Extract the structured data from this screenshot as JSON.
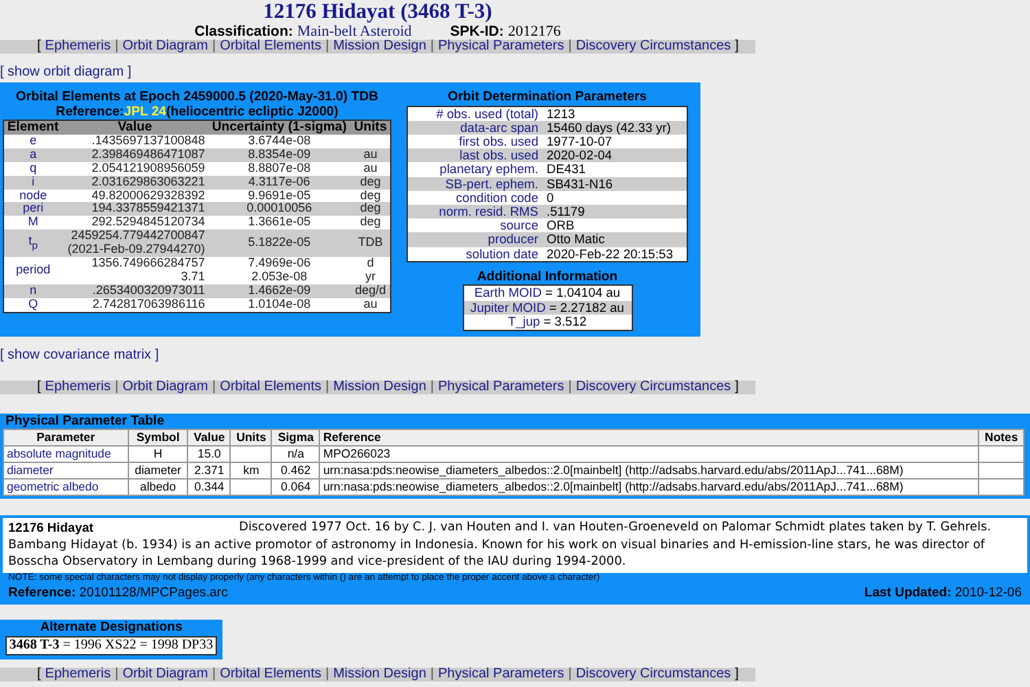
{
  "title": "12176 Hidayat (3468 T-3)",
  "classification": {
    "label": "Classification:",
    "value": "Main-belt Asteroid"
  },
  "spk_id": {
    "label": "SPK-ID:",
    "value": "2012176"
  },
  "nav_top": {
    "open": "[",
    "separator": "|",
    "close": "]",
    "links": [
      "Ephemeris",
      "Orbit Diagram",
      "Orbital Elements",
      "Mission Design",
      "Physical Parameters",
      "Discovery Circumstances"
    ]
  },
  "show_orbit_diagram": "[ show orbit diagram ]",
  "orbital_elements": {
    "title": "Orbital Elements at Epoch 2459000.5 (2020-May-31.0) TDB",
    "reference_label": "Reference:",
    "reference_value": "JPL 24",
    "reference_frame": "(heliocentric ecliptic J2000)",
    "columns": [
      "Element",
      "Value",
      "Uncertainty (1-sigma)",
      "Units"
    ],
    "rows": [
      {
        "element": "e",
        "value": [
          ".1435697137100848"
        ],
        "uncertainty": [
          "3.6744e-08"
        ],
        "units": []
      },
      {
        "element": "a",
        "value": [
          "2.398469486471087"
        ],
        "uncertainty": [
          "8.8354e-09"
        ],
        "units": [
          "au"
        ]
      },
      {
        "element": "q",
        "value": [
          "2.054121908956059"
        ],
        "uncertainty": [
          "8.8807e-08"
        ],
        "units": [
          "au"
        ]
      },
      {
        "element": "i",
        "value": [
          "2.031629863063221"
        ],
        "uncertainty": [
          "4.3117e-06"
        ],
        "units": [
          "deg"
        ]
      },
      {
        "element": "node",
        "value": [
          "49.82000629328392"
        ],
        "uncertainty": [
          "9.9691e-05"
        ],
        "units": [
          "deg"
        ]
      },
      {
        "element": "peri",
        "value": [
          "194.3378559421371"
        ],
        "uncertainty": [
          "0.00010056"
        ],
        "units": [
          "deg"
        ]
      },
      {
        "element": "M",
        "value": [
          "292.5294845120734"
        ],
        "uncertainty": [
          "1.3661e-05"
        ],
        "units": [
          "deg"
        ]
      },
      {
        "element": "t$_{p}$",
        "value": [
          "2459254.779442700847",
          "(2021-Feb-09.27944270)"
        ],
        "uncertainty": [
          "5.1822e-05"
        ],
        "units": [
          "TDB"
        ]
      },
      {
        "element": "period",
        "value": [
          "1356.749666284757",
          "3.71"
        ],
        "uncertainty": [
          "7.4969e-06",
          "2.053e-08"
        ],
        "units": [
          "d",
          "yr"
        ]
      },
      {
        "element": "n",
        "value": [
          ".2653400320973011"
        ],
        "uncertainty": [
          "1.4662e-09"
        ],
        "units": [
          "deg/d"
        ]
      },
      {
        "element": "Q",
        "value": [
          "2.742817063986116"
        ],
        "uncertainty": [
          "1.0104e-08"
        ],
        "units": [
          "au"
        ]
      }
    ]
  },
  "orbit_determination": {
    "title": "Orbit Determination Parameters",
    "rows": [
      {
        "label": "# obs. used (total)",
        "value": "1213"
      },
      {
        "label": "data-arc span",
        "value": "15460 days (42.33 yr)"
      },
      {
        "label": "first obs. used",
        "value": "1977-10-07"
      },
      {
        "label": "last obs. used",
        "value": "2020-02-04"
      },
      {
        "label": "planetary ephem.",
        "value": "DE431"
      },
      {
        "label": "SB-pert. ephem.",
        "value": "SB431-N16"
      },
      {
        "label": "condition code",
        "value": "0"
      },
      {
        "label": "norm. resid. RMS",
        "value": ".51179"
      },
      {
        "label": "source",
        "value": "ORB"
      },
      {
        "label": "producer",
        "value": "Otto Matic"
      },
      {
        "label": "solution date",
        "value": "2020-Feb-22 20:15:53"
      }
    ]
  },
  "additional_information": {
    "title": "Additional Information",
    "rows": [
      {
        "label": "Earth MOID",
        "value": "= 1.04104 au"
      },
      {
        "label": "Jupiter MOID",
        "value": "= 2.27182 au"
      },
      {
        "label": "T_jup",
        "value": "= 3.512"
      }
    ]
  },
  "show_covariance_matrix": "[ show covariance matrix ]",
  "nav_middle": {
    "open": "[",
    "separator": "|",
    "close": "]",
    "links": [
      "Ephemeris",
      "Orbit Diagram",
      "Orbital Elements",
      "Mission Design",
      "Physical Parameters",
      "Discovery Circumstances"
    ]
  },
  "physical_parameters": {
    "title": "Physical Parameter Table",
    "columns": [
      "Parameter",
      "Symbol",
      "Value",
      "Units",
      "Sigma",
      "Reference",
      "Notes"
    ],
    "rows": [
      {
        "parameter": "absolute magnitude",
        "symbol": "H",
        "value": "15.0",
        "units": "",
        "sigma": "n/a",
        "reference": "MPO266023",
        "notes": ""
      },
      {
        "parameter": "diameter",
        "symbol": "diameter",
        "value": "2.371",
        "units": "km",
        "sigma": "0.462",
        "reference": "urn:nasa:pds:neowise_diameters_albedos::2.0[mainbelt] (http://adsabs.harvard.edu/abs/2011ApJ...741...68M)",
        "notes": ""
      },
      {
        "parameter": "geometric albedo",
        "symbol": "albedo",
        "value": "0.344",
        "units": "",
        "sigma": "0.064",
        "reference": "urn:nasa:pds:neowise_diameters_albedos::2.0[mainbelt] (http://adsabs.harvard.edu/abs/2011ApJ...741...68M)",
        "notes": ""
      }
    ]
  },
  "discovery": {
    "name": "12176 Hidayat",
    "circumstances": "Discovered 1977 Oct. 16 by C. J. van Houten and I. van Houten-Groeneveld on Palomar Schmidt plates taken by T. Gehrels.",
    "citation": "Bambang Hidayat (b. 1934) is an active promotor of astronomy in Indonesia. Known for his work on visual binaries and H-emission-line stars, he was director of Bosscha Observatory in Lembang during 1968-1999 and vice-president of the IAU during 1994-2000.",
    "note": "NOTE: some special characters may not display properly (any characters within () are an attempt to place the proper accent above a character)",
    "reference_label": "Reference:",
    "reference_value": "20101128/MPCPages.arc",
    "updated_label": "Last Updated:",
    "updated_value": "2010-12-06"
  },
  "alternate_designations": {
    "title": "Alternate Designations",
    "text": "**3468 T-3** = 1996 XS22 = 1998 DP33"
  },
  "nav_bottom": {
    "open": "[",
    "separator": "|",
    "close": "]",
    "links": [
      "Ephemeris",
      "Orbit Diagram",
      "Orbital Elements",
      "Mission Design",
      "Physical Parameters",
      "Discovery Circumstances"
    ]
  }
}
